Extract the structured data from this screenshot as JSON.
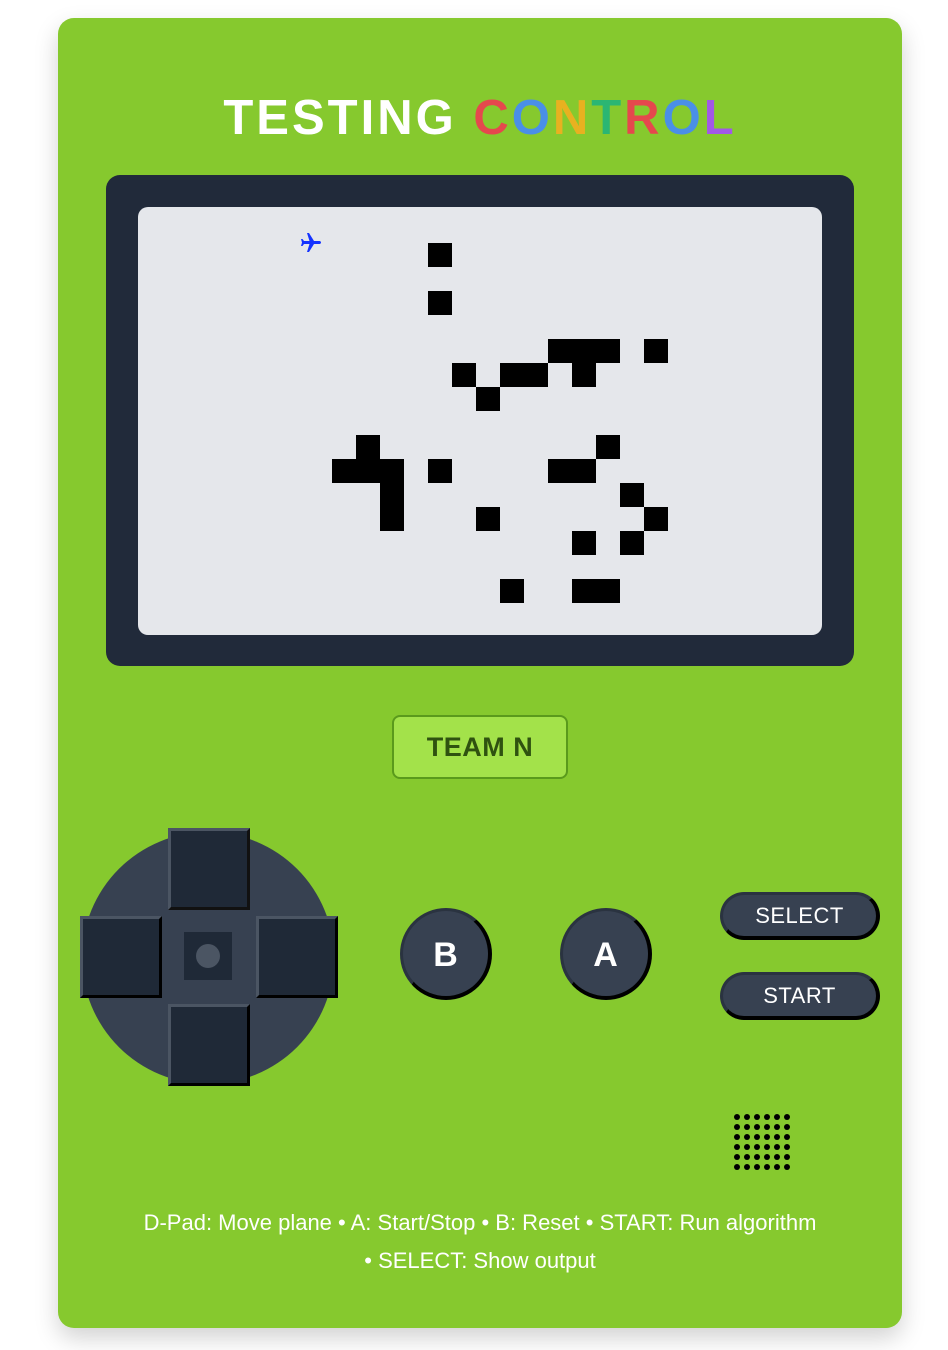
{
  "header": {
    "title_plain": "TESTING ",
    "title_colored": [
      {
        "ch": "C",
        "color": "#e5484d"
      },
      {
        "ch": "O",
        "color": "#4a8fe7"
      },
      {
        "ch": "N",
        "color": "#e8b120"
      },
      {
        "ch": "T",
        "color": "#2bb673"
      },
      {
        "ch": "R",
        "color": "#e5484d"
      },
      {
        "ch": "O",
        "color": "#4a8fe7"
      },
      {
        "ch": "L",
        "color": "#a259e6"
      }
    ]
  },
  "screen": {
    "grid_cell": "obstacle",
    "plane": {
      "icon": "airplane-icon",
      "color": "#1533ff",
      "col": 6,
      "row": 1
    },
    "obstacles": [
      [
        12,
        1
      ],
      [
        12,
        3
      ],
      [
        17,
        5
      ],
      [
        18,
        5
      ],
      [
        19,
        5
      ],
      [
        21,
        5
      ],
      [
        13,
        6
      ],
      [
        15,
        6
      ],
      [
        16,
        6
      ],
      [
        18,
        6
      ],
      [
        14,
        7
      ],
      [
        9,
        9
      ],
      [
        19,
        9
      ],
      [
        8,
        10
      ],
      [
        9,
        10
      ],
      [
        10,
        10
      ],
      [
        12,
        10
      ],
      [
        17,
        10
      ],
      [
        18,
        10
      ],
      [
        10,
        11
      ],
      [
        20,
        11
      ],
      [
        10,
        12
      ],
      [
        14,
        12
      ],
      [
        21,
        12
      ],
      [
        18,
        13
      ],
      [
        20,
        13
      ],
      [
        15,
        15
      ],
      [
        18,
        15
      ],
      [
        19,
        15
      ]
    ]
  },
  "team": {
    "label": "TEAM N"
  },
  "buttons": {
    "b_label": "B",
    "a_label": "A",
    "select_label": "SELECT",
    "start_label": "START"
  },
  "help": {
    "line1": "D-Pad: Move plane • A: Start/Stop • B: Reset • START: Run algorithm",
    "line2": "• SELECT: Show output"
  },
  "colors": {
    "body": "#86c92e",
    "bezel": "#212a3a",
    "screen": "#e5e7eb",
    "button": "#374151",
    "team_badge": "#a3e24a"
  }
}
